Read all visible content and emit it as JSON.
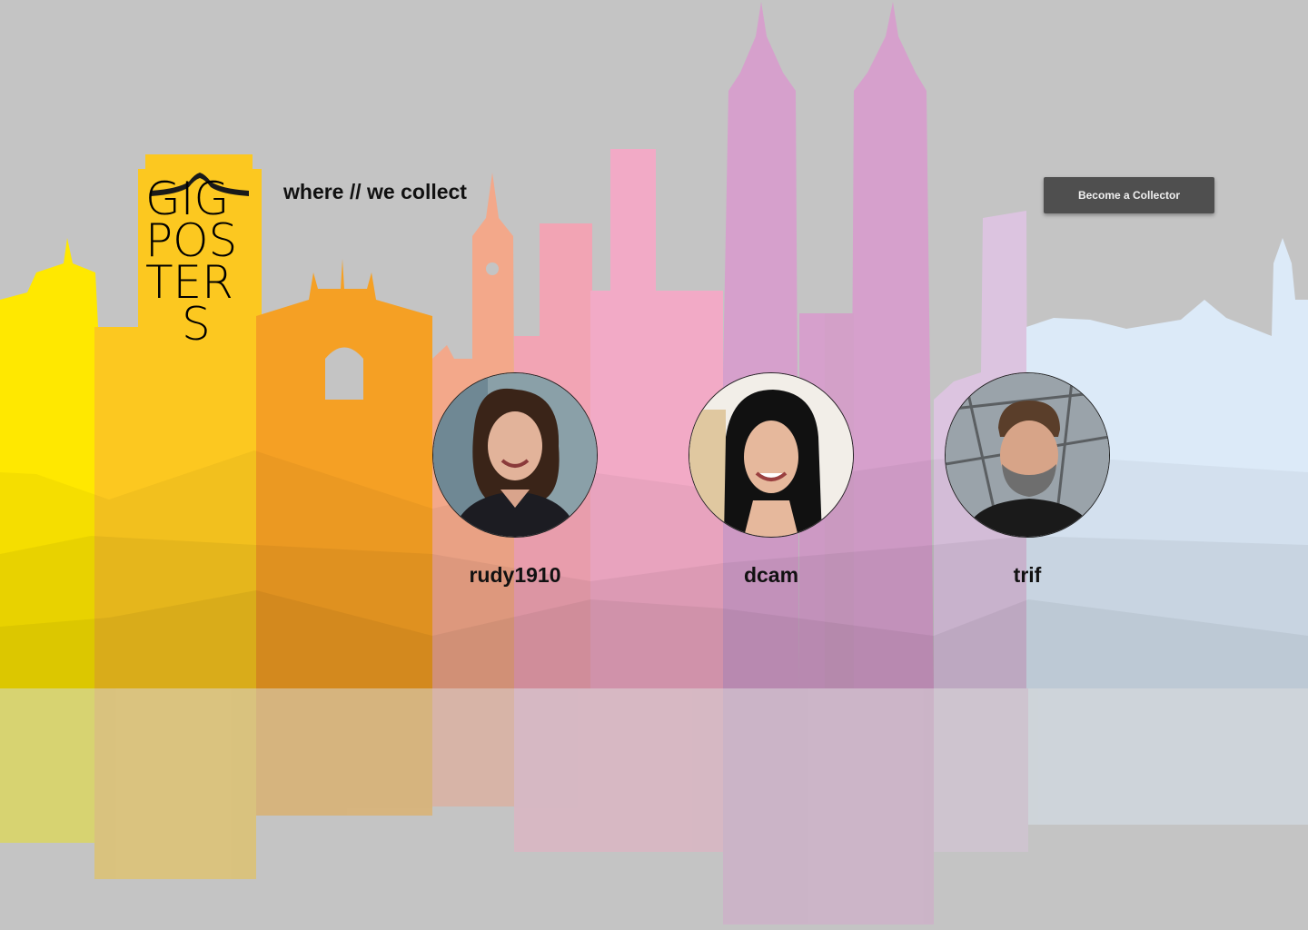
{
  "brand": {
    "logo_rows": [
      "GIG",
      "POS",
      "TER",
      "S"
    ],
    "tagline": "where // we collect"
  },
  "header": {
    "cta_label": "Become a Collector"
  },
  "collectors": [
    {
      "name": "rudy1910"
    },
    {
      "name": "dcam"
    },
    {
      "name": "trif"
    }
  ],
  "colors": {
    "background": "#c4c4c4",
    "logo_yellow": "#fcc820",
    "cta_background": "#4f4f4f",
    "skyline": [
      "#ffe800",
      "#fcc820",
      "#f5a024",
      "#f3a88a",
      "#f2aac6",
      "#d6a2ca",
      "#dcc4e0",
      "#dceaf8"
    ]
  }
}
